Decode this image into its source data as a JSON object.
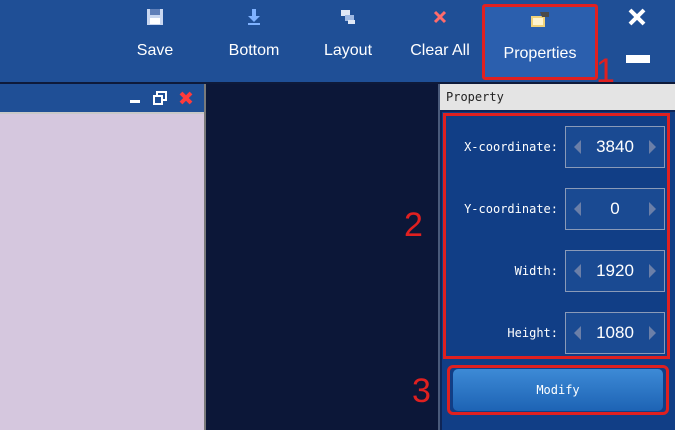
{
  "toolbar": {
    "save_label": "Save",
    "bottom_label": "Bottom",
    "layout_label": "Layout",
    "clear_all_label": "Clear All",
    "properties_label": "Properties"
  },
  "property_panel": {
    "header": "Property",
    "fields": [
      {
        "label": "X-coordinate:",
        "value": "3840"
      },
      {
        "label": "Y-coordinate:",
        "value": "0"
      },
      {
        "label": "Width:",
        "value": "1920"
      },
      {
        "label": "Height:",
        "value": "1080"
      }
    ],
    "modify_label": "Modify"
  },
  "markers": [
    "1",
    "2",
    "3"
  ],
  "colors": {
    "toolbar_bg": "#1f4f96",
    "panel_bg": "#113e86",
    "highlight": "#e02020",
    "subwindow_bg": "#d5c7de"
  },
  "icons": [
    "save-icon",
    "bottom-arrow-icon",
    "layout-icon",
    "clear-all-icon",
    "properties-icon",
    "close-icon",
    "minimize-icon"
  ]
}
